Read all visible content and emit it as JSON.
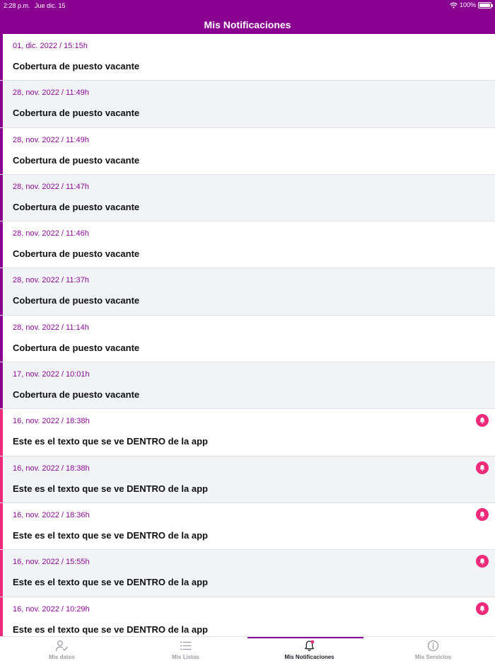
{
  "status_bar": {
    "time": "2:28 p.m.",
    "date": "Jue dic. 15",
    "battery": "100%"
  },
  "header": {
    "title": "Mis Notificaciones"
  },
  "notifications": [
    {
      "date": "01, dic. 2022 / 15:15h",
      "title": "Cobertura de puesto vacante",
      "unread": false
    },
    {
      "date": "28, nov. 2022 / 11:49h",
      "title": "Cobertura de puesto vacante",
      "unread": false
    },
    {
      "date": "28, nov. 2022 / 11:49h",
      "title": "Cobertura de puesto vacante",
      "unread": false
    },
    {
      "date": "28, nov. 2022 / 11:47h",
      "title": "Cobertura de puesto vacante",
      "unread": false
    },
    {
      "date": "28, nov. 2022 / 11:46h",
      "title": "Cobertura de puesto vacante",
      "unread": false
    },
    {
      "date": "28, nov. 2022 / 11:37h",
      "title": "Cobertura de puesto vacante",
      "unread": false
    },
    {
      "date": "28, nov. 2022 / 11:14h",
      "title": "Cobertura de puesto vacante",
      "unread": false
    },
    {
      "date": "17, nov. 2022 / 10:01h",
      "title": "Cobertura de puesto vacante",
      "unread": false
    },
    {
      "date": "16, nov. 2022 / 18:38h",
      "title": "Este es el texto que se ve DENTRO de la app",
      "unread": true
    },
    {
      "date": "16, nov. 2022 / 18:38h",
      "title": "Este es el texto que se ve DENTRO de la app",
      "unread": true
    },
    {
      "date": "16, nov. 2022 / 18:36h",
      "title": "Este es el texto que se ve DENTRO de la app",
      "unread": true
    },
    {
      "date": "16, nov. 2022 / 15:55h",
      "title": "Este es el texto que se ve DENTRO de la app",
      "unread": true
    },
    {
      "date": "16, nov. 2022 / 10:29h",
      "title": "Este es el texto que se ve DENTRO de la app",
      "unread": true
    }
  ],
  "tabs": [
    {
      "label": "Mis datos",
      "icon": "person-check-icon",
      "active": false
    },
    {
      "label": "Mis Listas",
      "icon": "list-icon",
      "active": false
    },
    {
      "label": "Mis Notificaciones",
      "icon": "bell-icon",
      "active": true
    },
    {
      "label": "Mis Servicios",
      "icon": "info-icon",
      "active": false
    }
  ],
  "colors": {
    "brand": "#890091",
    "accent": "#ee2a7b",
    "row_alt": "#f1f3f7",
    "date_text": "#8a0a96"
  }
}
